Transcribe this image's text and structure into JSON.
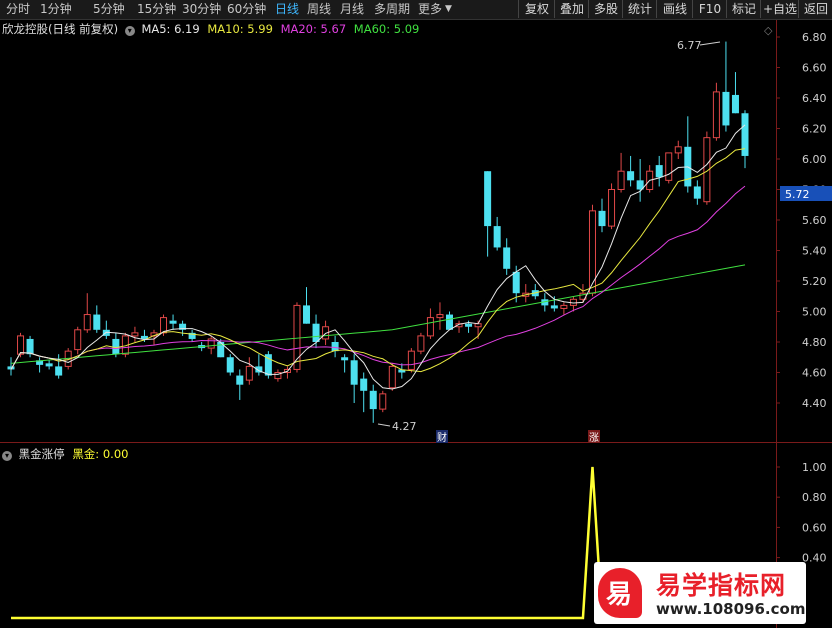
{
  "toolbar": {
    "tabs": [
      "分时",
      "1分钟",
      "5分钟",
      "15分钟",
      "30分钟",
      "60分钟",
      "日线",
      "周线",
      "月线",
      "多周期",
      "更多"
    ],
    "active": "日线",
    "buttons": [
      "复权",
      "叠加",
      "多股",
      "统计",
      "画线",
      "F10",
      "标记",
      "+自选",
      "返回"
    ]
  },
  "header": {
    "stock": "欣龙控股(日线 前复权)",
    "ma5": "MA5: 6.19",
    "ma10": "MA10: 5.99",
    "ma20": "MA20: 5.67",
    "ma60": "MA60: 5.09"
  },
  "colors": {
    "up": "#e04848",
    "down": "#4de0f0",
    "ma5": "#e8e8e8",
    "ma10": "#e8e840",
    "ma20": "#e040e0",
    "ma60": "#40e040",
    "indicator": "#ffff33"
  },
  "price_axis": {
    "labels": [
      "6.80",
      "6.60",
      "6.40",
      "6.20",
      "6.00",
      "5.80",
      "5.60",
      "5.40",
      "5.20",
      "5.00",
      "4.80",
      "4.60",
      "4.40"
    ],
    "current": "5.72"
  },
  "annotations": {
    "high": "6.77",
    "low": "4.27",
    "cai": "财",
    "zhang": "涨"
  },
  "indicator": {
    "title": "黑金涨停",
    "series_label": "黑金:",
    "series_value": "0.00",
    "axis_labels": [
      "1.00",
      "0.80",
      "0.60",
      "0.40"
    ]
  },
  "watermark": {
    "glyph": "易",
    "title": "易学指标网",
    "url": "www.108096.com"
  },
  "chart_data": [
    {
      "type": "candlestick",
      "title": "欣龙控股(日线 前复权)",
      "ylim": [
        4.2,
        6.9
      ],
      "ohlc": [
        [
          4.64,
          4.7,
          4.58,
          4.62
        ],
        [
          4.72,
          4.86,
          4.7,
          4.84
        ],
        [
          4.82,
          4.84,
          4.7,
          4.72
        ],
        [
          4.68,
          4.7,
          4.6,
          4.65
        ],
        [
          4.66,
          4.68,
          4.62,
          4.64
        ],
        [
          4.64,
          4.72,
          4.56,
          4.58
        ],
        [
          4.64,
          4.76,
          4.62,
          4.74
        ],
        [
          4.75,
          4.9,
          4.72,
          4.88
        ],
        [
          4.88,
          5.12,
          4.86,
          4.98
        ],
        [
          4.98,
          5.04,
          4.86,
          4.88
        ],
        [
          4.88,
          4.94,
          4.82,
          4.84
        ],
        [
          4.82,
          4.86,
          4.7,
          4.72
        ],
        [
          4.72,
          4.86,
          4.7,
          4.84
        ],
        [
          4.84,
          4.9,
          4.8,
          4.86
        ],
        [
          4.84,
          4.88,
          4.8,
          4.82
        ],
        [
          4.84,
          4.88,
          4.78,
          4.86
        ],
        [
          4.86,
          4.98,
          4.84,
          4.96
        ],
        [
          4.94,
          4.98,
          4.88,
          4.92
        ],
        [
          4.92,
          4.94,
          4.84,
          4.88
        ],
        [
          4.86,
          4.88,
          4.8,
          4.82
        ],
        [
          4.78,
          4.8,
          4.74,
          4.76
        ],
        [
          4.76,
          4.84,
          4.72,
          4.82
        ],
        [
          4.8,
          4.82,
          4.7,
          4.7
        ],
        [
          4.7,
          4.72,
          4.58,
          4.6
        ],
        [
          4.58,
          4.62,
          4.42,
          4.52
        ],
        [
          4.55,
          4.7,
          4.52,
          4.64
        ],
        [
          4.64,
          4.72,
          4.58,
          4.6
        ],
        [
          4.72,
          4.74,
          4.56,
          4.58
        ],
        [
          4.56,
          4.62,
          4.54,
          4.6
        ],
        [
          4.6,
          4.64,
          4.56,
          4.62
        ],
        [
          4.62,
          5.06,
          4.6,
          5.04
        ],
        [
          5.04,
          5.16,
          4.92,
          4.92
        ],
        [
          4.92,
          4.98,
          4.76,
          4.8
        ],
        [
          4.82,
          4.94,
          4.78,
          4.9
        ],
        [
          4.8,
          4.84,
          4.7,
          4.74
        ],
        [
          4.7,
          4.72,
          4.6,
          4.68
        ],
        [
          4.68,
          4.72,
          4.4,
          4.52
        ],
        [
          4.56,
          4.6,
          4.34,
          4.48
        ],
        [
          4.48,
          4.52,
          4.27,
          4.36
        ],
        [
          4.36,
          4.48,
          4.34,
          4.46
        ],
        [
          4.5,
          4.66,
          4.48,
          4.64
        ],
        [
          4.62,
          4.66,
          4.56,
          4.6
        ],
        [
          4.62,
          4.76,
          4.6,
          4.74
        ],
        [
          4.74,
          4.86,
          4.72,
          4.84
        ],
        [
          4.84,
          5.02,
          4.82,
          4.96
        ],
        [
          4.96,
          5.06,
          4.88,
          4.98
        ],
        [
          4.98,
          5.0,
          4.88,
          4.88
        ],
        [
          4.9,
          4.94,
          4.86,
          4.92
        ],
        [
          4.92,
          4.94,
          4.86,
          4.9
        ],
        [
          4.9,
          4.94,
          4.82,
          4.92
        ],
        [
          5.92,
          5.92,
          5.36,
          5.56
        ],
        [
          5.56,
          5.62,
          5.4,
          5.42
        ],
        [
          5.42,
          5.48,
          5.24,
          5.28
        ],
        [
          5.26,
          5.3,
          5.06,
          5.12
        ],
        [
          5.1,
          5.18,
          5.06,
          5.12
        ],
        [
          5.14,
          5.18,
          5.08,
          5.1
        ],
        [
          5.08,
          5.12,
          5.0,
          5.04
        ],
        [
          5.04,
          5.1,
          5.0,
          5.02
        ],
        [
          5.02,
          5.06,
          4.98,
          5.04
        ],
        [
          5.04,
          5.1,
          5.0,
          5.08
        ],
        [
          5.08,
          5.18,
          5.06,
          5.12
        ],
        [
          5.12,
          5.7,
          5.1,
          5.66
        ],
        [
          5.66,
          5.74,
          5.52,
          5.56
        ],
        [
          5.56,
          5.84,
          5.54,
          5.8
        ],
        [
          5.8,
          6.04,
          5.78,
          5.92
        ],
        [
          5.92,
          6.02,
          5.82,
          5.86
        ],
        [
          5.86,
          6.0,
          5.72,
          5.8
        ],
        [
          5.8,
          5.96,
          5.78,
          5.92
        ],
        [
          5.96,
          6.02,
          5.82,
          5.88
        ],
        [
          5.86,
          6.04,
          5.84,
          6.04
        ],
        [
          6.04,
          6.12,
          6.0,
          6.08
        ],
        [
          6.08,
          6.28,
          5.78,
          5.82
        ],
        [
          5.82,
          5.86,
          5.7,
          5.74
        ],
        [
          5.72,
          6.18,
          5.7,
          6.14
        ],
        [
          6.14,
          6.5,
          6.12,
          6.44
        ],
        [
          6.44,
          6.77,
          6.18,
          6.22
        ],
        [
          6.42,
          6.57,
          6.3,
          6.3
        ],
        [
          6.3,
          6.32,
          5.94,
          6.02
        ]
      ]
    },
    {
      "type": "line",
      "title": "黑金涨停",
      "ylim": [
        0,
        1.05
      ],
      "series": [
        {
          "name": "黑金",
          "values": [
            0,
            0,
            0,
            0,
            0,
            0,
            0,
            0,
            0,
            0,
            0,
            0,
            0,
            0,
            0,
            0,
            0,
            0,
            0,
            0,
            0,
            0,
            0,
            0,
            0,
            0,
            0,
            0,
            0,
            0,
            0,
            0,
            0,
            0,
            0,
            0,
            0,
            0,
            0,
            0,
            0,
            0,
            0,
            0,
            0,
            0,
            0,
            0,
            0,
            0,
            0,
            0,
            0,
            0,
            0,
            0,
            0,
            0,
            0,
            0,
            0,
            1,
            0,
            0,
            0,
            0,
            0,
            0,
            0,
            0,
            0,
            0,
            0,
            0,
            0,
            0,
            0,
            0
          ]
        }
      ]
    }
  ]
}
